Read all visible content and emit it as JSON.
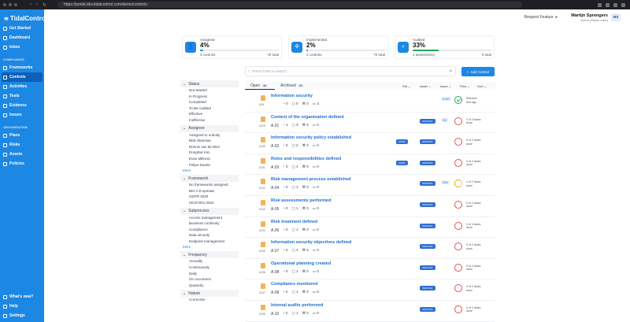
{
  "browser": {
    "url": "https://portal.dev.tidalcontrol.com/demo/controls"
  },
  "brand": {
    "name": "TidalControl",
    "accent": "#1d87e4"
  },
  "sidebar": {
    "top_items": [
      {
        "label": "Get Started",
        "icon": "rocket-icon"
      },
      {
        "label": "Dashboard",
        "icon": "dashboard-icon"
      },
      {
        "label": "Inbox",
        "icon": "inbox-icon"
      }
    ],
    "compliance_title": "COMPLIANCE",
    "compliance_items": [
      {
        "label": "Frameworks",
        "icon": "framework-icon"
      },
      {
        "label": "Controls",
        "icon": "controls-icon",
        "active": true
      },
      {
        "label": "Activities",
        "icon": "activity-icon"
      },
      {
        "label": "Tests",
        "icon": "test-icon"
      },
      {
        "label": "Evidence",
        "icon": "evidence-icon"
      },
      {
        "label": "Issues",
        "icon": "issue-icon"
      }
    ],
    "organisation_title": "ORGANISATION",
    "organisation_items": [
      {
        "label": "Plans",
        "icon": "plan-icon"
      },
      {
        "label": "Risks",
        "icon": "risk-icon"
      },
      {
        "label": "Assets",
        "icon": "asset-icon"
      },
      {
        "label": "Policies",
        "icon": "policy-icon"
      }
    ],
    "bottom_items": [
      {
        "label": "What's new?",
        "icon": "megaphone-icon"
      },
      {
        "label": "Help",
        "icon": "help-icon"
      },
      {
        "label": "Settings",
        "icon": "gear-icon"
      }
    ]
  },
  "header": {
    "request_feature": "Request Feature",
    "user_name": "Martijn Sprengers",
    "user_org": "Demo (Super User)",
    "user_initials": "MS"
  },
  "summary": [
    {
      "label": "Assigned",
      "percent": "4%",
      "progress": 0.04,
      "left": "3 controls",
      "right": "70 total",
      "color": "#1d87e4",
      "icon": "user-icon"
    },
    {
      "label": "Implemented",
      "percent": "2%",
      "progress": 0.02,
      "left": "2 controls",
      "right": "70 total",
      "color": "#1d87e4",
      "icon": "cog-icon"
    },
    {
      "label": "Audited",
      "percent": "33%",
      "progress": 0.33,
      "left": "1 assessment",
      "right": "3 total",
      "color": "#22a55b",
      "icon": "search-icon"
    }
  ],
  "filters": [
    {
      "title": "Status",
      "options": [
        "Not Started",
        "In Progress",
        "Completed",
        "To Be Audited",
        "Effective",
        "Ineffective"
      ],
      "more": ""
    },
    {
      "title": "Assignee",
      "options": [
        "Assigned to nobody",
        "Blok Steeman",
        "Dennis van de Wiel",
        "Donghwi Kim",
        "Evan Milkovic",
        "Felipe Duarte"
      ],
      "more": "More"
    },
    {
      "title": "Framework",
      "options": [
        "No frameworks assigned",
        "BIO 2.0-opmaat",
        "GDPR 2020",
        "ISO27001:2022"
      ],
      "more": ""
    },
    {
      "title": "Subprocess",
      "options": [
        "Access management",
        "Business continuity",
        "Compliance",
        "Data security",
        "Endpoint management"
      ],
      "more": "More"
    },
    {
      "title": "Frequency",
      "options": [
        "Annually",
        "Continuously",
        "Daily",
        "On occurence",
        "Quarterly"
      ],
      "more": ""
    },
    {
      "title": "Nature",
      "options": [
        "Corrective"
      ],
      "more": ""
    }
  ],
  "toolbar": {
    "search_placeholder": "Press Enter to search",
    "add_label": "Add Control",
    "tab_open": "Open",
    "tab_open_count": "36",
    "tab_archived": "Archived",
    "tab_archived_count": "33",
    "col_std": "Std",
    "col_asset": "Asset",
    "col_issue": "Issue",
    "col_plan": "Plan",
    "col_sort": "Sort"
  },
  "rows": [
    {
      "id": "#28",
      "title": "Information security",
      "code": "",
      "stats": [
        "0",
        "0",
        "0",
        "3"
      ],
      "badges": [],
      "initials": "S.6S",
      "status": "ok",
      "status_text": "Effective",
      "status_sub": "89d ago"
    },
    {
      "id": "#229",
      "title": "Context of the organisation defined",
      "code": "A.01",
      "stats": [
        "1",
        "3",
        "0",
        "0"
      ],
      "badges": [
        "ISO27001"
      ],
      "initials": "SS",
      "status": "red",
      "status_text": "1 of 3 tasks",
      "status_sub": "done"
    },
    {
      "id": "#230",
      "title": "Information security policy established",
      "code": "A.02",
      "stats": [
        "0",
        "2",
        "0",
        "0"
      ],
      "badges": [
        "GDPR",
        "ISO27001"
      ],
      "initials": "",
      "status": "red",
      "status_text": "0 of 2 tasks",
      "status_sub": "done"
    },
    {
      "id": "#231",
      "title": "Roles and responsibilities defined",
      "code": "A.03",
      "stats": [
        "0",
        "1",
        "0",
        "0"
      ],
      "badges": [
        "GDPR",
        "ISO27001"
      ],
      "initials": "",
      "status": "red",
      "status_text": "0 of 2 tasks",
      "status_sub": "done"
    },
    {
      "id": "#232",
      "title": "Risk management process established",
      "code": "A.04",
      "stats": [
        "0",
        "1",
        "0",
        "0"
      ],
      "badges": [
        "ISO27001"
      ],
      "initials": "DW",
      "status": "half",
      "status_text": "1 of 2 tasks",
      "status_sub": "done"
    },
    {
      "id": "#233",
      "title": "Risk assessments performed",
      "code": "A.05",
      "stats": [
        "0",
        "1",
        "0",
        "0"
      ],
      "badges": [
        "ISO27001"
      ],
      "initials": "",
      "status": "red",
      "status_text": "0 of 2 tasks",
      "status_sub": "done"
    },
    {
      "id": "#234",
      "title": "Risk treatment defined",
      "code": "A.06",
      "stats": [
        "0",
        "1",
        "0",
        "0"
      ],
      "badges": [
        "ISO27001"
      ],
      "initials": "",
      "status": "red",
      "status_text": "0 of 4 tasks",
      "status_sub": "done"
    },
    {
      "id": "#235",
      "title": "Information security objectives defined",
      "code": "A.07",
      "stats": [
        "0",
        "1",
        "0",
        "0"
      ],
      "badges": [
        "ISO27001"
      ],
      "initials": "",
      "status": "red",
      "status_text": "0 of 2 tasks",
      "status_sub": "done"
    },
    {
      "id": "#236",
      "title": "Operational planning created",
      "code": "A.08",
      "stats": [
        "0",
        "1",
        "0",
        "0"
      ],
      "badges": [
        "ISO27001"
      ],
      "initials": "",
      "status": "red",
      "status_text": "0 of 2 tasks",
      "status_sub": "done"
    },
    {
      "id": "#237",
      "title": "Compliance monitored",
      "code": "A.09",
      "stats": [
        "0",
        "1",
        "0",
        "0"
      ],
      "badges": [
        "ISO27001"
      ],
      "initials": "",
      "status": "red",
      "status_text": "0 of 2 tasks",
      "status_sub": "done"
    },
    {
      "id": "#238",
      "title": "Internal audits performed",
      "code": "A.10",
      "stats": [
        "0",
        "1",
        "0",
        "0"
      ],
      "badges": [
        "ISO27001"
      ],
      "initials": "",
      "status": "red",
      "status_text": "0 of 2 tasks",
      "status_sub": "done"
    }
  ]
}
